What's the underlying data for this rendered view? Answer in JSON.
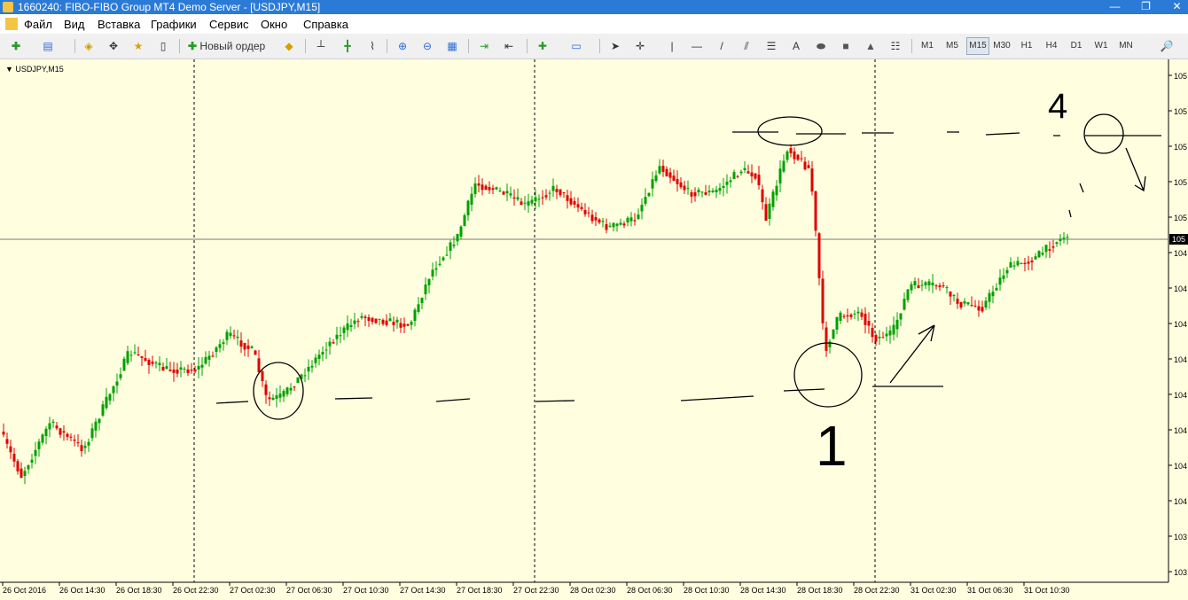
{
  "window": {
    "title": "1660240: FIBO-FIBO Group MT4 Demo Server - [USDJPY,M15]",
    "controls": [
      "—",
      "❐",
      "✕"
    ]
  },
  "menu": [
    "Файл",
    "Вид",
    "Вставка",
    "Графики",
    "Сервис",
    "Окно",
    "Справка"
  ],
  "toolbar": {
    "new_order_label": "Новый ордер",
    "line_tool_glyphs": [
      "|",
      "—",
      "/"
    ],
    "text_tool": "A",
    "timeframes": [
      "M1",
      "M5",
      "M15",
      "M30",
      "H1",
      "H4",
      "D1",
      "W1",
      "MN"
    ],
    "active_timeframe": "M15",
    "search_icon": "🔎"
  },
  "chart": {
    "symbol_label": "USDJPY,M15",
    "price_tags": [
      "105",
      "105",
      "105",
      "105",
      "105",
      "104",
      "104",
      "104",
      "104",
      "104",
      "104",
      "104",
      "104",
      "103",
      "103",
      "103"
    ],
    "current_price_tag": "105",
    "time_labels": [
      "26 Oct 2016",
      "26 Oct 14:30",
      "26 Oct 18:30",
      "26 Oct 22:30",
      "27 Oct 02:30",
      "27 Oct 06:30",
      "27 Oct 10:30",
      "27 Oct 14:30",
      "27 Oct 18:30",
      "27 Oct 22:30",
      "28 Oct 02:30",
      "28 Oct 06:30",
      "28 Oct 10:30",
      "28 Oct 14:30",
      "28 Oct 18:30",
      "28 Oct 22:30",
      "31 Oct 02:30",
      "31 Oct 06:30",
      "31 Oct 10:30"
    ],
    "colors": {
      "bull": "#00a000",
      "bear": "#e00000",
      "background": "#ffffe0",
      "grid": "#000000"
    },
    "annotations": {
      "label_1": "1",
      "label_4": "4"
    }
  },
  "chart_data": {
    "type": "candlestick",
    "symbol": "USDJPY",
    "timeframe": "M15",
    "x": [
      "26 Oct 2016",
      "26 Oct 14:30",
      "26 Oct 18:30",
      "26 Oct 22:30",
      "27 Oct 02:30",
      "27 Oct 06:30",
      "27 Oct 10:30",
      "27 Oct 14:30",
      "27 Oct 18:30",
      "27 Oct 22:30",
      "28 Oct 02:30",
      "28 Oct 06:30",
      "28 Oct 10:30",
      "28 Oct 14:30",
      "28 Oct 18:30",
      "28 Oct 22:30",
      "31 Oct 02:30",
      "31 Oct 06:30",
      "31 Oct 10:30"
    ],
    "close_rel": [
      0.32,
      0.44,
      0.58,
      0.52,
      0.48,
      0.5,
      0.62,
      0.72,
      0.92,
      0.96,
      0.93,
      0.92,
      0.95,
      1.0,
      0.58,
      0.66,
      0.72,
      0.76,
      0.86
    ],
    "note": ""
  }
}
